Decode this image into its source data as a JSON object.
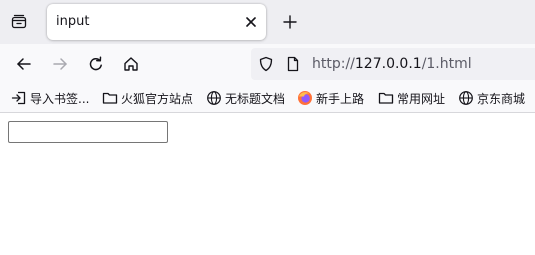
{
  "tab": {
    "title": "input"
  },
  "navbar": {
    "url_scheme": "http://",
    "url_host": "127.0.0.1",
    "url_path": "/1.html"
  },
  "bookmarks": [
    {
      "label": "导入书签...",
      "icon": "import-icon"
    },
    {
      "label": "火狐官方站点",
      "icon": "folder-icon"
    },
    {
      "label": "无标题文档",
      "icon": "globe-icon"
    },
    {
      "label": "新手上路",
      "icon": "firefox-icon"
    },
    {
      "label": "常用网址",
      "icon": "folder-icon"
    },
    {
      "label": "京东商城",
      "icon": "globe-icon"
    }
  ],
  "page": {
    "input_value": "",
    "input_placeholder": ""
  },
  "colors": {
    "tabstrip": "#eeeef2",
    "toolbar": "#f9f9fb",
    "urlbar": "#f0f0f4",
    "text": "#15141a",
    "muted": "#5b5b66"
  }
}
